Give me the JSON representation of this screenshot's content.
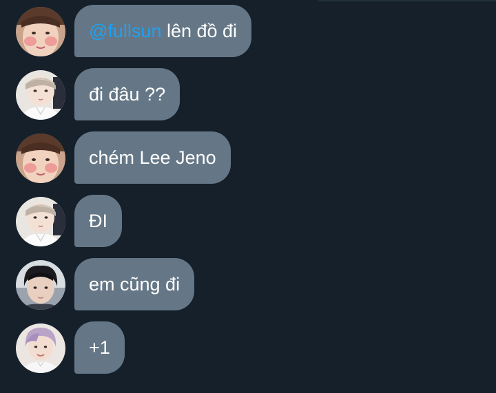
{
  "messages": [
    {
      "avatar": "avatar-user-a",
      "mention": "@fullsun",
      "text": " lên đồ đi"
    },
    {
      "avatar": "avatar-user-b",
      "mention": "",
      "text": "đi đâu ??"
    },
    {
      "avatar": "avatar-user-a",
      "mention": "",
      "text": "chém Lee Jeno"
    },
    {
      "avatar": "avatar-user-b",
      "mention": "",
      "text": "ĐI"
    },
    {
      "avatar": "avatar-user-c",
      "mention": "",
      "text": "em cũng đi"
    },
    {
      "avatar": "avatar-user-d",
      "mention": "",
      "text": "+1"
    }
  ],
  "colors": {
    "background": "#15202b",
    "bubble": "#657786",
    "text": "#ffffff",
    "mention": "#1da1f2"
  }
}
